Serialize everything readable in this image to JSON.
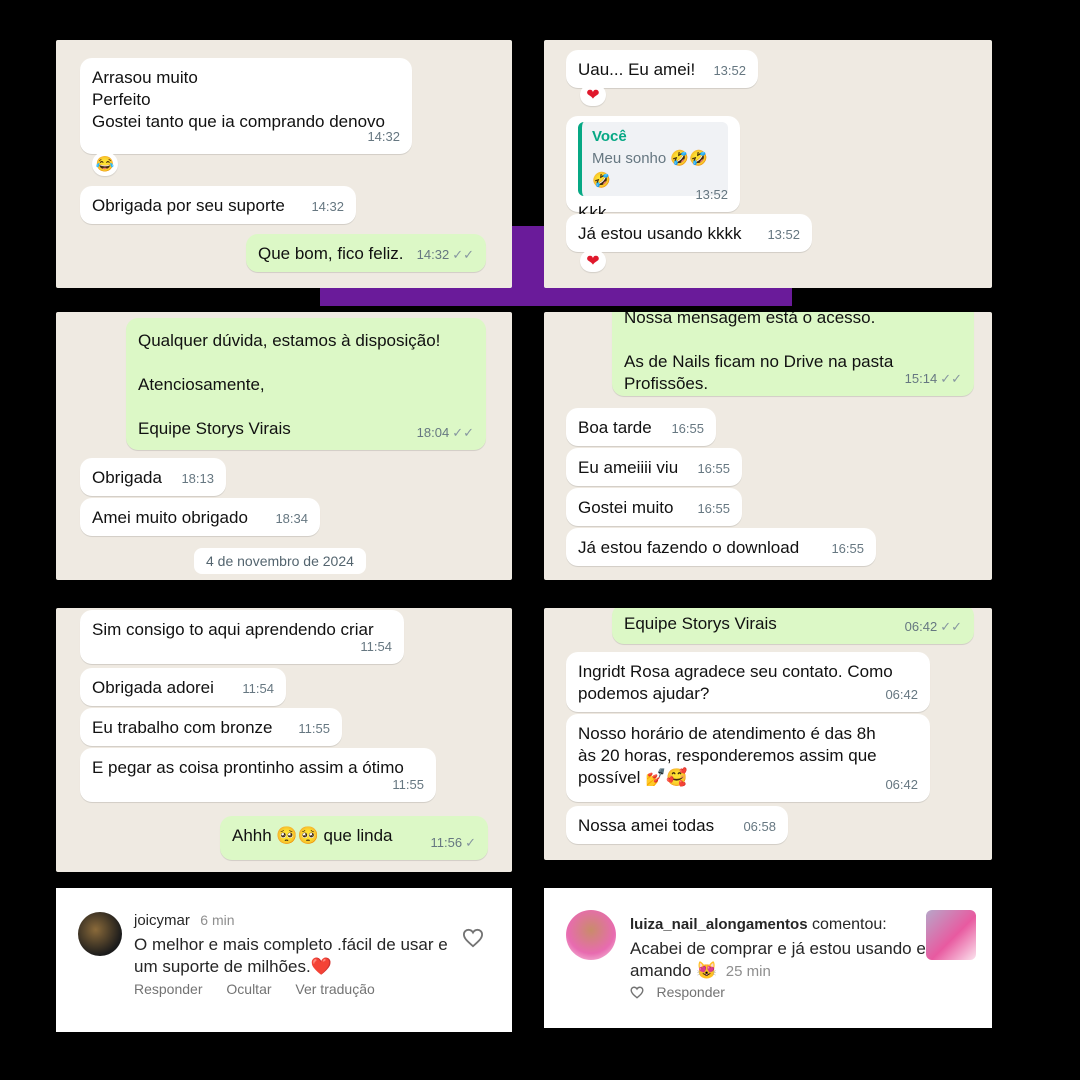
{
  "panel1": {
    "msgs": [
      {
        "text": "Arrasou muito\nPerfeito\nGostei tanto que ia comprando denovo",
        "time": "14:32"
      },
      {
        "text": "Obrigada por seu suporte",
        "time": "14:32"
      },
      {
        "text": "Que bom, fico feliz.",
        "time": "14:32"
      }
    ],
    "reaction": "😂"
  },
  "panel2": {
    "msgs": [
      {
        "text": "Uau... Eu amei!",
        "time": "13:52"
      },
      {
        "quote_author": "Você",
        "quote_text": "Meu sonho 🤣🤣🤣",
        "text": "Kkk",
        "time": "13:52"
      },
      {
        "text": "Já estou usando kkkk",
        "time": "13:52"
      }
    ],
    "heart": "❤"
  },
  "panel3": {
    "msgs": [
      {
        "text": "Qualquer dúvida, estamos à disposição!\n\nAtenciosamente,\n\nEquipe Storys Virais",
        "time": "18:04"
      },
      {
        "text": "Obrigada",
        "time": "18:13"
      },
      {
        "text": "Amei muito obrigado",
        "time": "18:34"
      }
    ],
    "date": "4 de novembro de 2024"
  },
  "panel4": {
    "msgs": [
      {
        "text": "Nossa mensagem está o acesso.\n\nAs de Nails ficam no Drive na pasta\nProfissões.",
        "time": "15:14"
      },
      {
        "text": "Boa tarde",
        "time": "16:55"
      },
      {
        "text": "Eu ameiiii viu",
        "time": "16:55"
      },
      {
        "text": "Gostei muito",
        "time": "16:55"
      },
      {
        "text": "Já estou fazendo o download",
        "time": "16:55"
      }
    ]
  },
  "panel5": {
    "msgs": [
      {
        "text": "Sim consigo to aqui aprendendo criar",
        "time": "11:54"
      },
      {
        "text": "Obrigada adorei",
        "time": "11:54"
      },
      {
        "text": "Eu trabalho com bronze",
        "time": "11:55"
      },
      {
        "text": "E pegar as coisa prontinho assim a ótimo",
        "time": "11:55"
      },
      {
        "text": "Ahhh 🥺🥺 que linda",
        "time": "11:56"
      }
    ]
  },
  "panel6": {
    "msgs": [
      {
        "text": "Equipe Storys Virais",
        "time": "06:42"
      },
      {
        "text": "Ingridt Rosa agradece seu contato. Como\npodemos ajudar?",
        "time": "06:42"
      },
      {
        "text": "Nosso horário de atendimento é das 8h\nàs 20 horas, responderemos assim que\npossível 💅🥰",
        "time": "06:42"
      },
      {
        "text": "Nossa amei todas",
        "time": "06:58"
      }
    ]
  },
  "comment1": {
    "user": "joicymar",
    "time": "6 min",
    "text": "O melhor e mais completo .fácil de usar e\num suporte de milhões.❤️",
    "actions": [
      "Responder",
      "Ocultar",
      "Ver tradução"
    ]
  },
  "comment2": {
    "user": "luiza_nail_alongamentos",
    "verb": "comentou:",
    "text": "Acabei de comprar e já estou usando e\namando 😻",
    "time": "25 min",
    "reply": "Responder"
  },
  "colors": {
    "accent": "#6a1b9a",
    "bubble_out": "#dcf8c6",
    "bubble_in": "#ffffff",
    "chat_bg": "#efeae2"
  }
}
